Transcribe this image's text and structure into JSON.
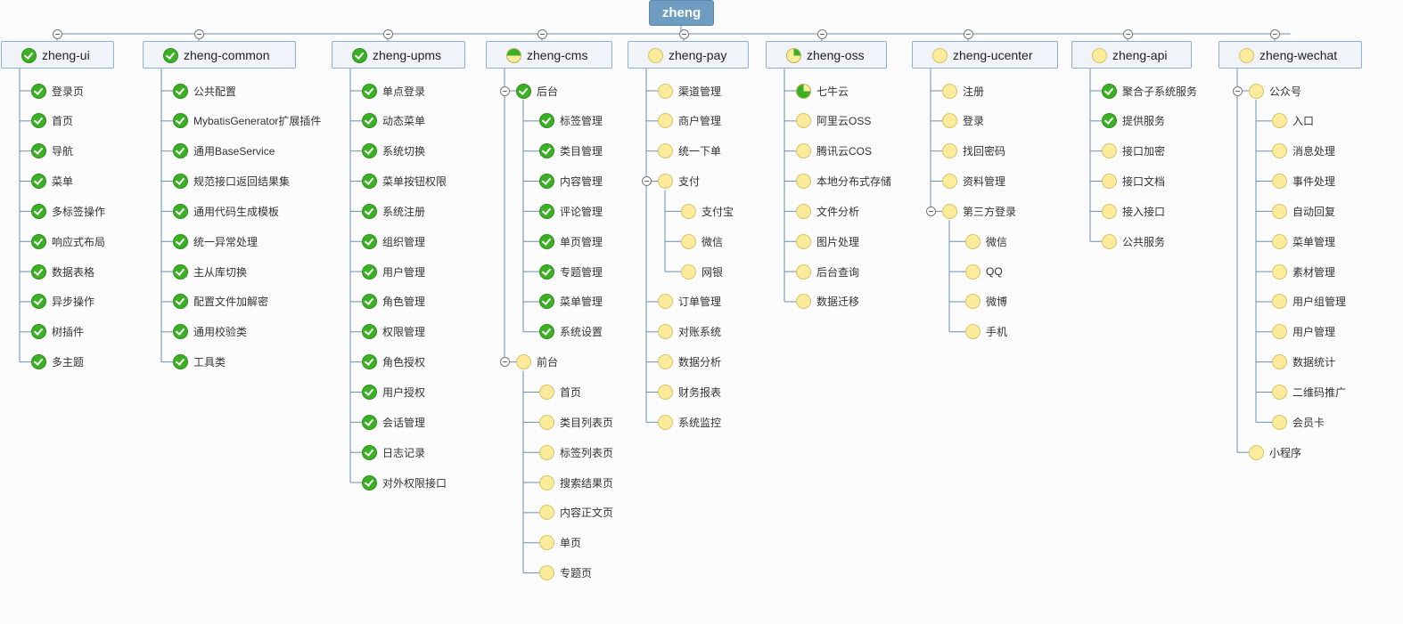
{
  "root": {
    "label": "zheng"
  },
  "colors": {
    "done": "#3cb025",
    "todo": "#fbeb9a",
    "root_bg": "#6f9dc2",
    "line": "#6b8fb0"
  },
  "categories": [
    {
      "id": "ui",
      "label": "zheng-ui",
      "status": "done",
      "items": [
        {
          "label": "登录页",
          "status": "done"
        },
        {
          "label": "首页",
          "status": "done"
        },
        {
          "label": "导航",
          "status": "done"
        },
        {
          "label": "菜单",
          "status": "done"
        },
        {
          "label": "多标签操作",
          "status": "done"
        },
        {
          "label": "响应式布局",
          "status": "done"
        },
        {
          "label": "数据表格",
          "status": "done"
        },
        {
          "label": "异步操作",
          "status": "done"
        },
        {
          "label": "树插件",
          "status": "done"
        },
        {
          "label": "多主题",
          "status": "done"
        }
      ]
    },
    {
      "id": "common",
      "label": "zheng-common",
      "status": "done",
      "items": [
        {
          "label": "公共配置",
          "status": "done"
        },
        {
          "label": "MybatisGenerator扩展插件",
          "status": "done"
        },
        {
          "label": "通用BaseService",
          "status": "done"
        },
        {
          "label": "规范接口返回结果集",
          "status": "done"
        },
        {
          "label": "通用代码生成模板",
          "status": "done"
        },
        {
          "label": "统一异常处理",
          "status": "done"
        },
        {
          "label": "主从库切换",
          "status": "done"
        },
        {
          "label": "配置文件加解密",
          "status": "done"
        },
        {
          "label": "通用校验类",
          "status": "done"
        },
        {
          "label": "工具类",
          "status": "done"
        }
      ]
    },
    {
      "id": "upms",
      "label": "zheng-upms",
      "status": "done",
      "items": [
        {
          "label": "单点登录",
          "status": "done"
        },
        {
          "label": "动态菜单",
          "status": "done"
        },
        {
          "label": "系统切换",
          "status": "done"
        },
        {
          "label": "菜单按钮权限",
          "status": "done"
        },
        {
          "label": "系统注册",
          "status": "done"
        },
        {
          "label": "组织管理",
          "status": "done"
        },
        {
          "label": "用户管理",
          "status": "done"
        },
        {
          "label": "角色管理",
          "status": "done"
        },
        {
          "label": "权限管理",
          "status": "done"
        },
        {
          "label": "角色授权",
          "status": "done"
        },
        {
          "label": "用户授权",
          "status": "done"
        },
        {
          "label": "会话管理",
          "status": "done"
        },
        {
          "label": "日志记录",
          "status": "done"
        },
        {
          "label": "对外权限接口",
          "status": "done"
        }
      ]
    },
    {
      "id": "cms",
      "label": "zheng-cms",
      "status": "half",
      "items": [
        {
          "label": "后台",
          "status": "done",
          "children": [
            {
              "label": "标签管理",
              "status": "done"
            },
            {
              "label": "类目管理",
              "status": "done"
            },
            {
              "label": "内容管理",
              "status": "done"
            },
            {
              "label": "评论管理",
              "status": "done"
            },
            {
              "label": "单页管理",
              "status": "done"
            },
            {
              "label": "专题管理",
              "status": "done"
            },
            {
              "label": "菜单管理",
              "status": "done"
            },
            {
              "label": "系统设置",
              "status": "done"
            }
          ]
        },
        {
          "label": "前台",
          "status": "todo",
          "children": [
            {
              "label": "首页",
              "status": "todo"
            },
            {
              "label": "类目列表页",
              "status": "todo"
            },
            {
              "label": "标签列表页",
              "status": "todo"
            },
            {
              "label": "搜索结果页",
              "status": "todo"
            },
            {
              "label": "内容正文页",
              "status": "todo"
            },
            {
              "label": "单页",
              "status": "todo"
            },
            {
              "label": "专题页",
              "status": "todo"
            }
          ]
        }
      ]
    },
    {
      "id": "pay",
      "label": "zheng-pay",
      "status": "todo",
      "items": [
        {
          "label": "渠道管理",
          "status": "todo"
        },
        {
          "label": "商户管理",
          "status": "todo"
        },
        {
          "label": "统一下单",
          "status": "todo"
        },
        {
          "label": "支付",
          "status": "todo",
          "children": [
            {
              "label": "支付宝",
              "status": "todo"
            },
            {
              "label": "微信",
              "status": "todo"
            },
            {
              "label": "网银",
              "status": "todo"
            }
          ]
        },
        {
          "label": "订单管理",
          "status": "todo"
        },
        {
          "label": "对账系统",
          "status": "todo"
        },
        {
          "label": "数据分析",
          "status": "todo"
        },
        {
          "label": "财务报表",
          "status": "todo"
        },
        {
          "label": "系统监控",
          "status": "todo"
        }
      ]
    },
    {
      "id": "oss",
      "label": "zheng-oss",
      "status": "quarter",
      "items": [
        {
          "label": "七牛云",
          "status": "tq"
        },
        {
          "label": "阿里云OSS",
          "status": "todo"
        },
        {
          "label": "腾讯云COS",
          "status": "todo"
        },
        {
          "label": "本地分布式存储",
          "status": "todo"
        },
        {
          "label": "文件分析",
          "status": "todo"
        },
        {
          "label": "图片处理",
          "status": "todo"
        },
        {
          "label": "后台查询",
          "status": "todo"
        },
        {
          "label": "数据迁移",
          "status": "todo"
        }
      ]
    },
    {
      "id": "ucenter",
      "label": "zheng-ucenter",
      "status": "todo",
      "items": [
        {
          "label": "注册",
          "status": "todo"
        },
        {
          "label": "登录",
          "status": "todo"
        },
        {
          "label": "找回密码",
          "status": "todo"
        },
        {
          "label": "资料管理",
          "status": "todo"
        },
        {
          "label": "第三方登录",
          "status": "todo",
          "children": [
            {
              "label": "微信",
              "status": "todo"
            },
            {
              "label": "QQ",
              "status": "todo"
            },
            {
              "label": "微博",
              "status": "todo"
            },
            {
              "label": "手机",
              "status": "todo"
            }
          ]
        }
      ]
    },
    {
      "id": "api",
      "label": "zheng-api",
      "status": "todo",
      "items": [
        {
          "label": "聚合子系统服务",
          "status": "done"
        },
        {
          "label": "提供服务",
          "status": "done"
        },
        {
          "label": "接口加密",
          "status": "todo"
        },
        {
          "label": "接口文档",
          "status": "todo"
        },
        {
          "label": "接入接口",
          "status": "todo"
        },
        {
          "label": "公共服务",
          "status": "todo"
        }
      ]
    },
    {
      "id": "wechat",
      "label": "zheng-wechat",
      "status": "todo",
      "items": [
        {
          "label": "公众号",
          "status": "todo",
          "children": [
            {
              "label": "入口",
              "status": "todo"
            },
            {
              "label": "消息处理",
              "status": "todo"
            },
            {
              "label": "事件处理",
              "status": "todo"
            },
            {
              "label": "自动回复",
              "status": "todo"
            },
            {
              "label": "菜单管理",
              "status": "todo"
            },
            {
              "label": "素材管理",
              "status": "todo"
            },
            {
              "label": "用户组管理",
              "status": "todo"
            },
            {
              "label": "用户管理",
              "status": "todo"
            },
            {
              "label": "数据统计",
              "status": "todo"
            },
            {
              "label": "二维码推广",
              "status": "todo"
            },
            {
              "label": "会员卡",
              "status": "todo"
            }
          ]
        },
        {
          "label": "小程序",
          "status": "todo"
        }
      ]
    }
  ]
}
